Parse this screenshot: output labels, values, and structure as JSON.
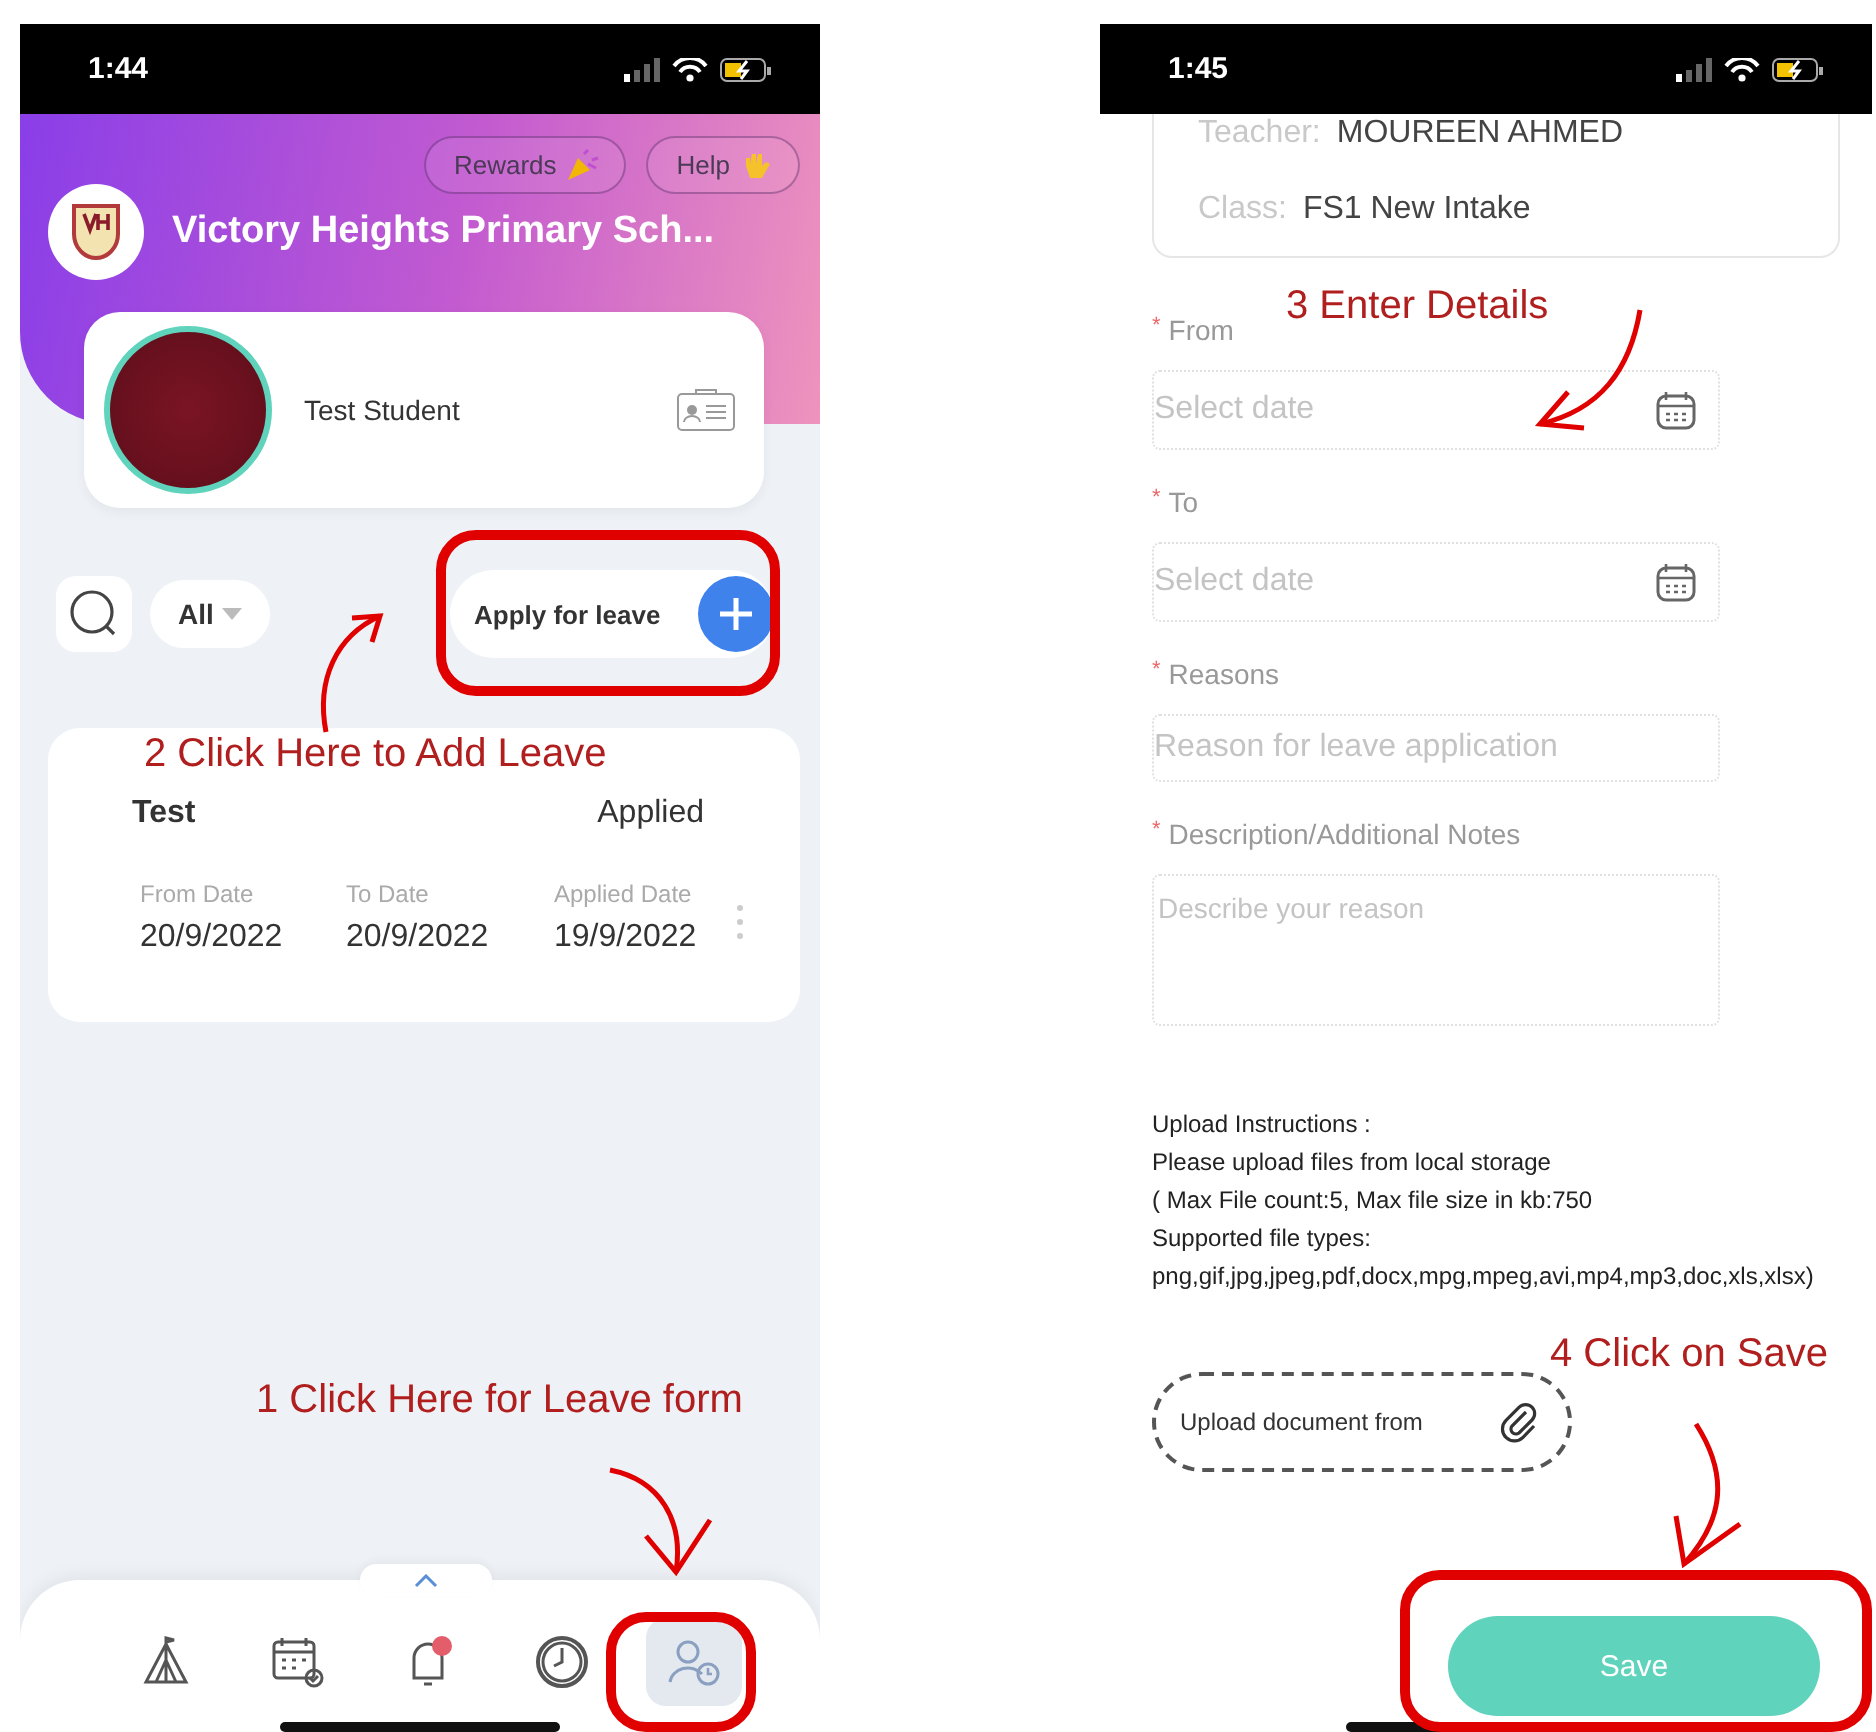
{
  "left_screen": {
    "status_bar": {
      "time": "1:44"
    },
    "header": {
      "buttons": [
        {
          "label": "Rewards",
          "kind": "party"
        },
        {
          "label": "Help",
          "kind": "wave"
        }
      ],
      "school_name": "Victory Heights Primary Sch..."
    },
    "student": {
      "name": "Test Student"
    },
    "filter": {
      "value": "All"
    },
    "apply_button": {
      "label": "Apply for leave"
    },
    "leaves": [
      {
        "title": "Test",
        "status": "Applied",
        "fields": [
          {
            "label": "From Date",
            "value": "20/9/2022"
          },
          {
            "label": "To Date",
            "value": "20/9/2022"
          },
          {
            "label": "Applied Date",
            "value": "19/9/2022"
          }
        ]
      }
    ],
    "nav": [
      {
        "kind": "tent",
        "selected": false
      },
      {
        "kind": "calendar",
        "selected": false
      },
      {
        "kind": "bell",
        "selected": false
      },
      {
        "kind": "clock",
        "selected": false
      },
      {
        "kind": "person",
        "selected": true
      }
    ]
  },
  "right_screen": {
    "status_bar": {
      "time": "1:45"
    },
    "class_card": [
      {
        "label": "Teacher:",
        "value": "MOUREEN AHMED"
      },
      {
        "label": "Class:",
        "value": "FS1 New Intake"
      }
    ],
    "form": [
      {
        "kind": "date",
        "marker": "*",
        "label": "From",
        "placeholder": "Select date"
      },
      {
        "kind": "date",
        "marker": "*",
        "label": "To",
        "placeholder": "Select date"
      },
      {
        "kind": "text",
        "marker": "*",
        "label": "Reasons",
        "placeholder": "Reason for leave application"
      },
      {
        "kind": "textarea",
        "marker": "*",
        "label": "Description/Additional Notes",
        "placeholder": "Describe your reason"
      }
    ],
    "upload_instructions": [
      "Upload Instructions :",
      "Please upload files from local storage",
      "( Max File count:5, Max file size in kb:750",
      "Supported file types:",
      "png,gif,jpg,jpeg,pdf,docx,mpg,mpeg,avi,mp4,mp3,doc,xls,xlsx)"
    ],
    "upload_button": {
      "label": "Upload document from"
    },
    "save_button": {
      "label": "Save"
    }
  },
  "annotations": [
    "2  Click Here to Add Leave",
    "1  Click Here for Leave form",
    "3  Enter Details",
    "4 Click on Save"
  ]
}
